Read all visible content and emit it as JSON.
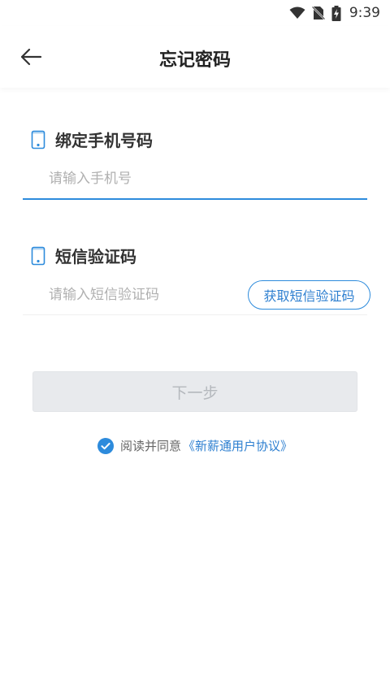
{
  "status_bar": {
    "time": "9:39"
  },
  "header": {
    "title": "忘记密码",
    "back_icon": "arrow-left-icon"
  },
  "phone_section": {
    "title": "绑定手机号码",
    "icon": "phone-icon",
    "placeholder": "请输入手机号",
    "value": ""
  },
  "sms_section": {
    "title": "短信验证码",
    "icon": "phone-icon",
    "placeholder": "请输入短信验证码",
    "value": "",
    "get_code_label": "获取短信验证码"
  },
  "next_button": {
    "label": "下一步",
    "enabled": false
  },
  "agreement": {
    "checked": true,
    "text": "阅读并同意",
    "link": "《新薪通用户协议》"
  },
  "colors": {
    "accent": "#2d8bdc",
    "disabled_bg": "#e8eaed",
    "disabled_text": "#b4b8bd"
  }
}
